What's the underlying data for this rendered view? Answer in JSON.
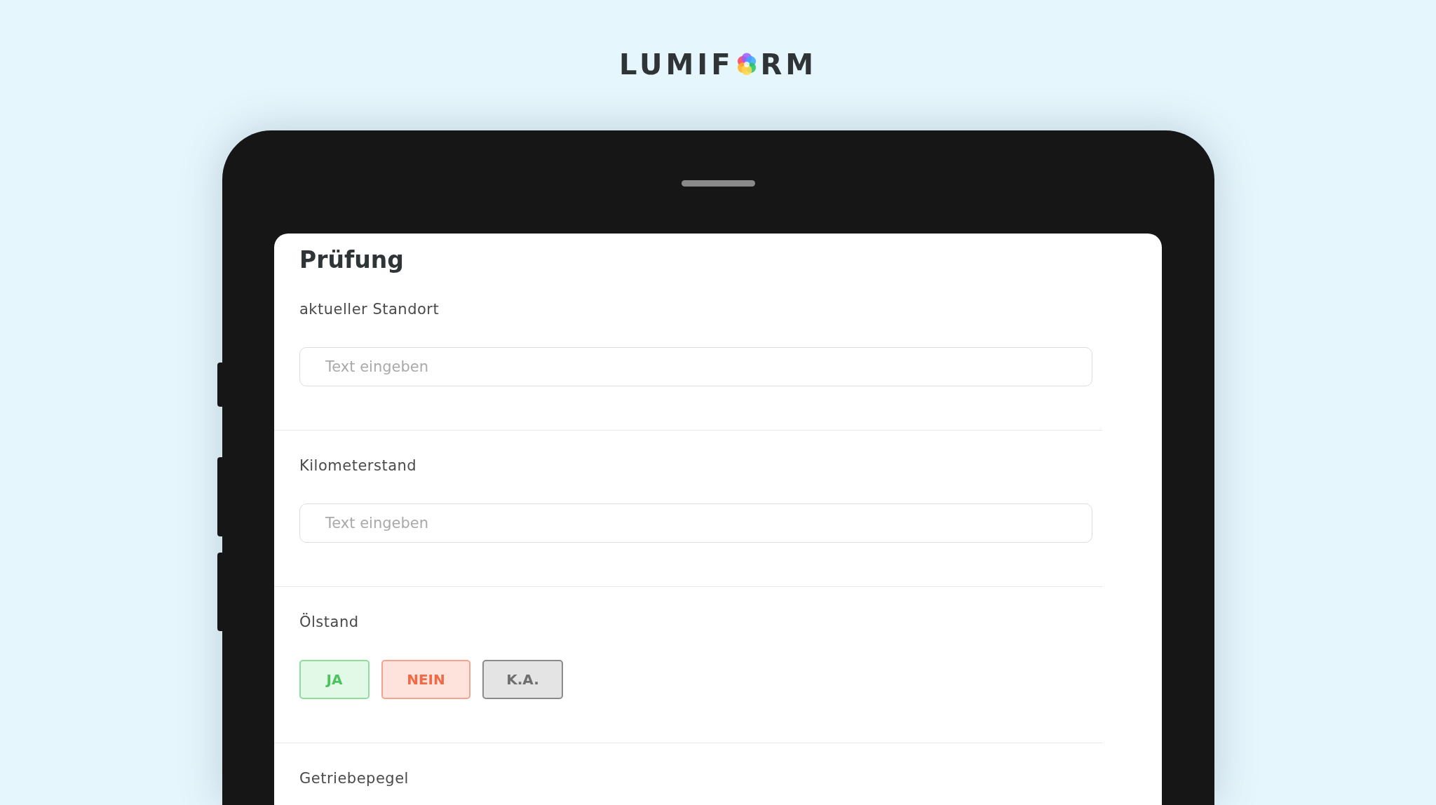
{
  "logo": {
    "start": "LUMIF",
    "end": "RM"
  },
  "form": {
    "title": "Prüfung",
    "sections": [
      {
        "kind": "text",
        "label": "aktueller Standort",
        "placeholder": "Text eingeben"
      },
      {
        "kind": "text",
        "label": "Kilometerstand",
        "placeholder": "Text eingeben"
      },
      {
        "kind": "choice",
        "label": "Ölstand",
        "options": [
          {
            "label": "JA",
            "kind": "yes"
          },
          {
            "label": "NEIN",
            "kind": "no"
          },
          {
            "label": "K.A.",
            "kind": "na"
          }
        ]
      },
      {
        "kind": "label",
        "label": "Getriebepegel"
      }
    ]
  }
}
